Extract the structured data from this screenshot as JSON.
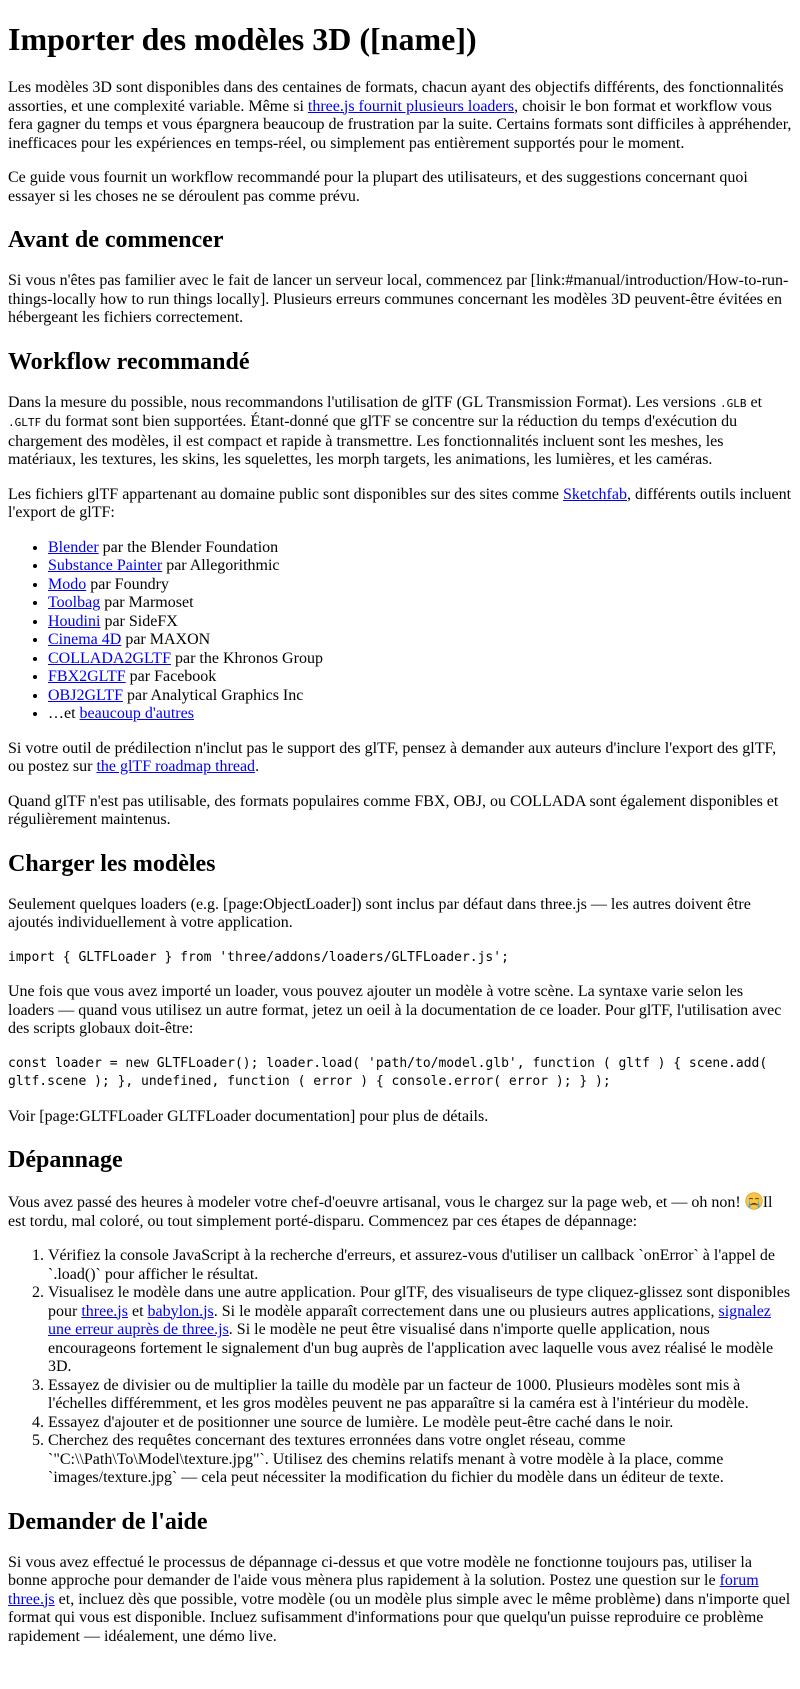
{
  "title": "Importer des modèles 3D ([name])",
  "intro": {
    "p1_a": "Les modèles 3D sont disponibles dans des centaines de formats, chacun ayant des objectifs différents, des fonctionnalités assorties, et une complexité variable. Même si ",
    "p1_link": "three.js fournit plusieurs loaders",
    "p1_b": ", choisir le bon format et workflow vous fera gagner du temps et vous épargnera beaucoup de frustration par la suite. Certains formats sont difficiles à appréhender, inefficaces pour les expériences en temps-réel, ou simplement pas entièrement supportés pour le moment.",
    "p2": "Ce guide vous fournit un workflow recommandé pour la plupart des utilisateurs, et des suggestions concernant quoi essayer si les choses ne se déroulent pas comme prévu."
  },
  "before": {
    "heading": "Avant de commencer",
    "text": "Si vous n'êtes pas familier avec le fait de lancer un serveur local, commencez par [link:#manual/introduction/How-to-run-things-locally how to run things locally]. Plusieurs erreurs communes concernant les modèles 3D peuvent-être évitées en hébergeant les fichiers correctement."
  },
  "workflow": {
    "heading": "Workflow recommandé",
    "p1_a": "Dans la mesure du possible, nous recommandons l'utilisation de glTF (GL Transmission Format). Les versions ",
    "glb": ".GLB",
    "p1_and": " et ",
    "gltf": ".GLTF",
    "p1_b": " du format sont bien supportées. Étant-donné que glTF se concentre sur la réduction du temps d'exécution du chargement des modèles, il est compact et rapide à transmettre. Les fonctionnalités incluent sont les meshes, les matériaux, les textures, les skins, les squelettes, les morph targets, les animations, les lumières, et les caméras.",
    "p2_a": "Les fichiers glTF appartenant au domaine public sont disponibles sur des sites comme ",
    "p2_link": "Sketchfab",
    "p2_b": ", différents outils incluent l'export de glTF:",
    "tools": [
      {
        "name": "Blender",
        "by": " par the Blender Foundation"
      },
      {
        "name": "Substance Painter",
        "by": " par Allegorithmic"
      },
      {
        "name": "Modo",
        "by": " par Foundry"
      },
      {
        "name": "Toolbag",
        "by": " par Marmoset"
      },
      {
        "name": "Houdini",
        "by": " par SideFX"
      },
      {
        "name": "Cinema 4D",
        "by": " par MAXON"
      },
      {
        "name": "COLLADA2GLTF",
        "by": " par the Khronos Group"
      },
      {
        "name": "FBX2GLTF",
        "by": " par Facebook"
      },
      {
        "name": "OBJ2GLTF",
        "by": " par Analytical Graphics Inc"
      }
    ],
    "more_prefix": "…et ",
    "more_link": "beaucoup d'autres",
    "p3_a": "Si votre outil de prédilection n'inclut pas le support des glTF, pensez à demander aux auteurs d'inclure l'export des glTF, ou postez sur ",
    "p3_link": "the glTF roadmap thread",
    "p3_b": ".",
    "p4": "Quand glTF n'est pas utilisable, des formats populaires comme FBX, OBJ, ou COLLADA sont également disponibles et régulièrement maintenus."
  },
  "loading": {
    "heading": "Charger les modèles",
    "p1": "Seulement quelques loaders (e.g. [page:ObjectLoader]) sont inclus par défaut dans three.js — les autres doivent être ajoutés individuellement à votre application.",
    "code1": "import { GLTFLoader } from 'three/addons/loaders/GLTFLoader.js';",
    "p2": "Une fois que vous avez importé un loader, vous pouvez ajouter un modèle à votre scène. La syntaxe varie selon les loaders — quand vous utilisez un autre format, jetez un oeil à la documentation de ce loader. Pour glTF, l'utilisation avec des scripts globaux doit-être:",
    "code2": "const loader = new GLTFLoader(); loader.load( 'path/to/model.glb', function ( gltf ) { scene.add( gltf.scene ); }, undefined, function ( error ) { console.error( error ); } );",
    "p3": "Voir [page:GLTFLoader GLTFLoader documentation] pour plus de détails."
  },
  "troubleshooting": {
    "heading": "Dépannage",
    "p1_a": "Vous avez passé des heures à modeler votre chef-d'oeuvre artisanal, vous le chargez sur la page web, et — oh non! ",
    "p1_b": "Il est tordu, mal coloré, ou tout simplement porté-disparu. Commencez par ces étapes de dépannage:",
    "step1": "Vérifiez la console JavaScript à la recherche d'erreurs, et assurez-vous d'utiliser un callback `onError` à l'appel de `.load()` pour afficher le résultat.",
    "step2_a": "Visualisez le modèle dans une autre application. Pour glTF, des visualiseurs de type cliquez-glissez sont disponibles pour ",
    "step2_link1": "three.js",
    "step2_and": " et ",
    "step2_link2": "babylon.js",
    "step2_b": ". Si le modèle apparaît correctement dans une ou plusieurs autres applications, ",
    "step2_link3": "signalez une erreur auprès de three.js",
    "step2_c": ". Si le modèle ne peut être visualisé dans n'importe quelle application, nous encourageons fortement le signalement d'un bug auprès de l'application avec laquelle vous avez réalisé le modèle 3D.",
    "step3": "Essayez de divisier ou de multiplier la taille du modèle par un facteur de 1000. Plusieurs modèles sont mis à l'échelles différemment, et les gros modèles peuvent ne pas apparaître si la caméra est à l'intérieur du modèle.",
    "step4": "Essayez d'ajouter et de positionner une source de lumière. Le modèle peut-être caché dans le noir.",
    "step5": "Cherchez des requêtes concernant des textures erronnées dans votre onglet réseau, comme `\"C:\\\\Path\\To\\Model\\texture.jpg\"`. Utilisez des chemins relatifs menant à votre modèle à la place, comme `images/texture.jpg` — cela peut nécessiter la modification du fichier du modèle dans un éditeur de texte."
  },
  "help": {
    "heading": "Demander de l'aide",
    "p1_a": "Si vous avez effectué le processus de dépannage ci-dessus et que votre modèle ne fonctionne toujours pas, utiliser la bonne approche pour demander de l'aide vous mènera plus rapidement à la solution. Postez une question sur le ",
    "p1_link": "forum three.js",
    "p1_b": " et, incluez dès que possible, votre modèle (ou un modèle plus simple avec le même problème) dans n'importe quel format qui vous est disponible. Incluez sufisamment d'informations pour que quelqu'un puisse reproduire ce problème rapidement — idéalement, une démo live."
  }
}
